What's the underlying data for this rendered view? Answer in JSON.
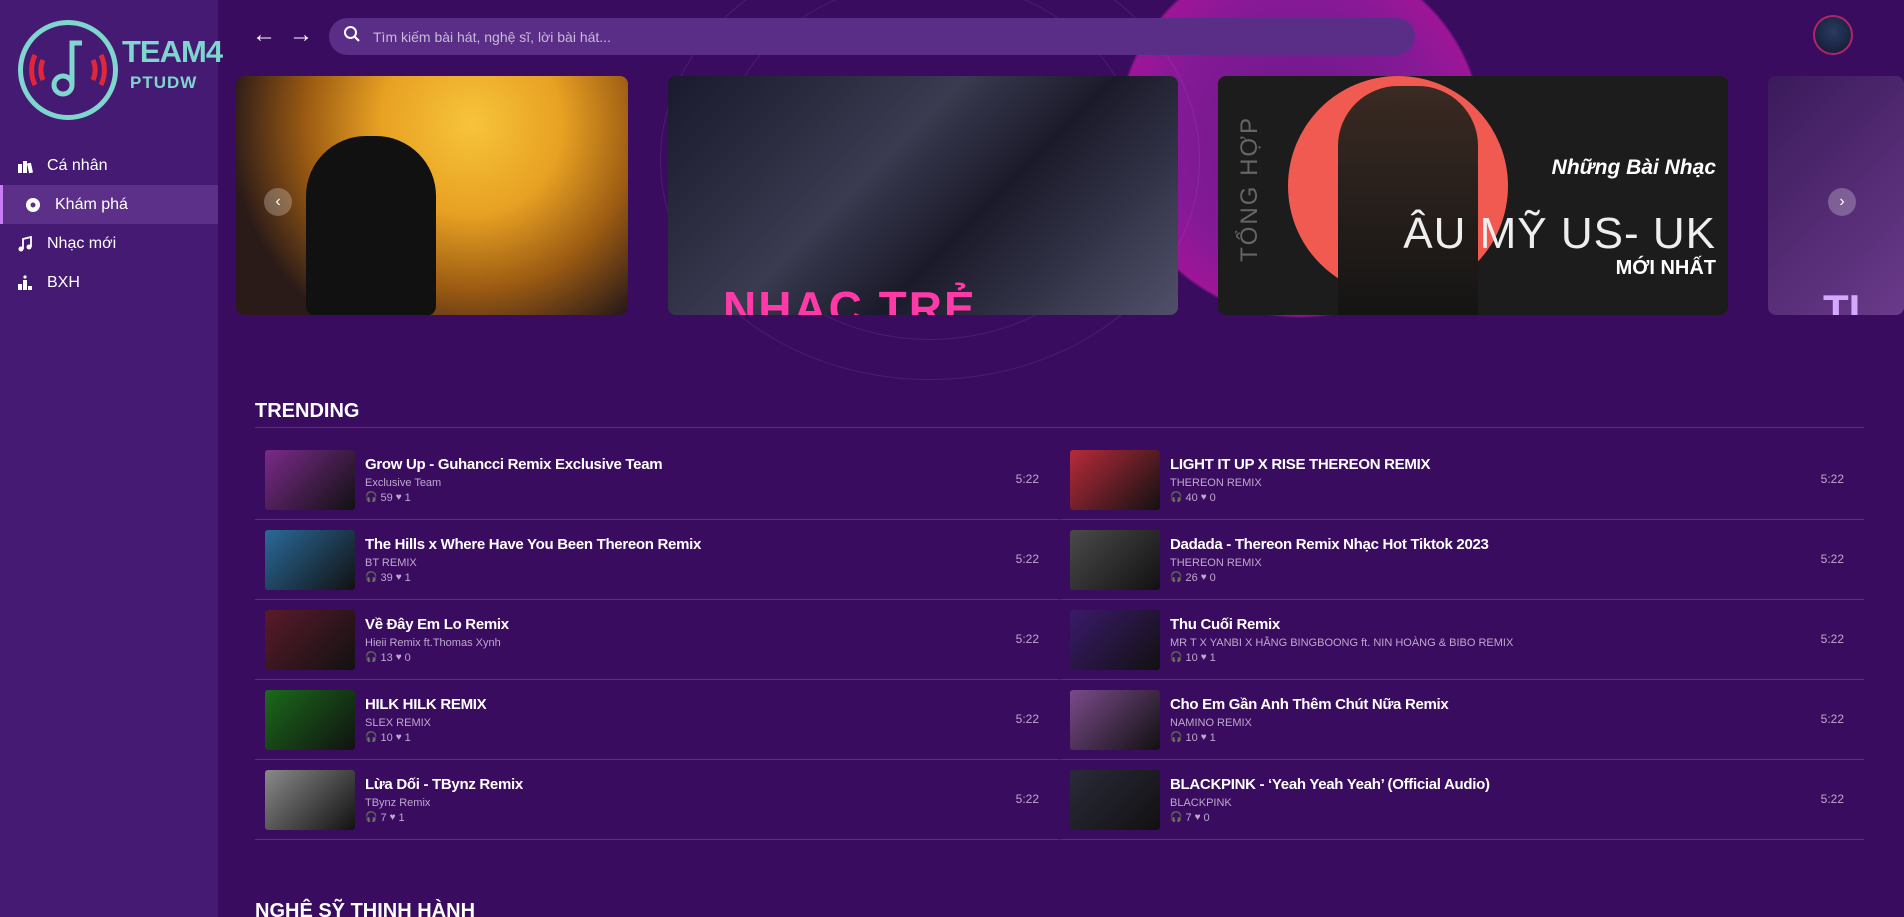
{
  "logo": {
    "text1": "TEAM4",
    "text2": "PTUDW"
  },
  "nav": [
    {
      "label": "Cá nhân",
      "icon": "library-icon"
    },
    {
      "label": "Khám phá",
      "icon": "disc-icon",
      "active": true
    },
    {
      "label": "Nhạc mới",
      "icon": "music-note-icon"
    },
    {
      "label": "BXH",
      "icon": "podium-icon"
    }
  ],
  "search": {
    "placeholder": "Tìm kiếm bài hát, nghệ sĩ, lời bài hát..."
  },
  "banners": {
    "b2_text": "NHẠC TRẺ",
    "b3_line1": "Những Bài Nhạc",
    "b3_line2": "ÂU MỸ US- UK",
    "b3_line3": "MỚI NHẤT",
    "b3_side": "TỔNG HỢP",
    "b4_text": "TI"
  },
  "sections": {
    "trending": "TRENDING",
    "artists": "NGHỆ SỸ THỊNH HÀNH"
  },
  "tracks_left": [
    {
      "title": "Grow Up - Guhancci Remix Exclusive Team",
      "artist": "Exclusive Team",
      "listens": "59",
      "likes": "1",
      "duration": "5:22",
      "color": "#7a2a8a"
    },
    {
      "title": "The Hills x Where Have You Been Thereon Remix",
      "artist": "BT REMIX",
      "listens": "39",
      "likes": "1",
      "duration": "5:22",
      "color": "#2a6a9a"
    },
    {
      "title": "Về Đây Em Lo Remix",
      "artist": "Hieii Remix ft.Thomas Xynh",
      "listens": "13",
      "likes": "0",
      "duration": "5:22",
      "color": "#5a1a2a"
    },
    {
      "title": "HILK HILK REMIX",
      "artist": "SLEX REMIX",
      "listens": "10",
      "likes": "1",
      "duration": "5:22",
      "color": "#1a6a1a"
    },
    {
      "title": "Lừa Dối - TBynz Remix",
      "artist": "TBynz Remix",
      "listens": "7",
      "likes": "1",
      "duration": "5:22",
      "color": "#8a8a8a"
    }
  ],
  "tracks_right": [
    {
      "title": "LIGHT IT UP X RISE THEREON REMIX",
      "artist": "THEREON REMIX",
      "listens": "40",
      "likes": "0",
      "duration": "5:22",
      "color": "#b82a3a"
    },
    {
      "title": "Dadada - Thereon Remix Nhạc Hot Tiktok 2023",
      "artist": "THEREON REMIX",
      "listens": "26",
      "likes": "0",
      "duration": "5:22",
      "color": "#4a4a4a"
    },
    {
      "title": "Thu Cuối Remix",
      "artist": "MR T X YANBI X HẰNG BINGBOONG ft. NIN HOÀNG & BIBO REMIX",
      "listens": "10",
      "likes": "1",
      "duration": "5:22",
      "color": "#3a1a6a"
    },
    {
      "title": "Cho Em Gần Anh Thêm Chút Nữa Remix",
      "artist": "NAMINO REMIX",
      "listens": "10",
      "likes": "1",
      "duration": "5:22",
      "color": "#7a4a8a"
    },
    {
      "title": "BLACKPINK - ‘Yeah Yeah Yeah’ (Official Audio)",
      "artist": "BLACKPINK",
      "listens": "7",
      "likes": "0",
      "duration": "5:22",
      "color": "#2a2a3a"
    }
  ]
}
